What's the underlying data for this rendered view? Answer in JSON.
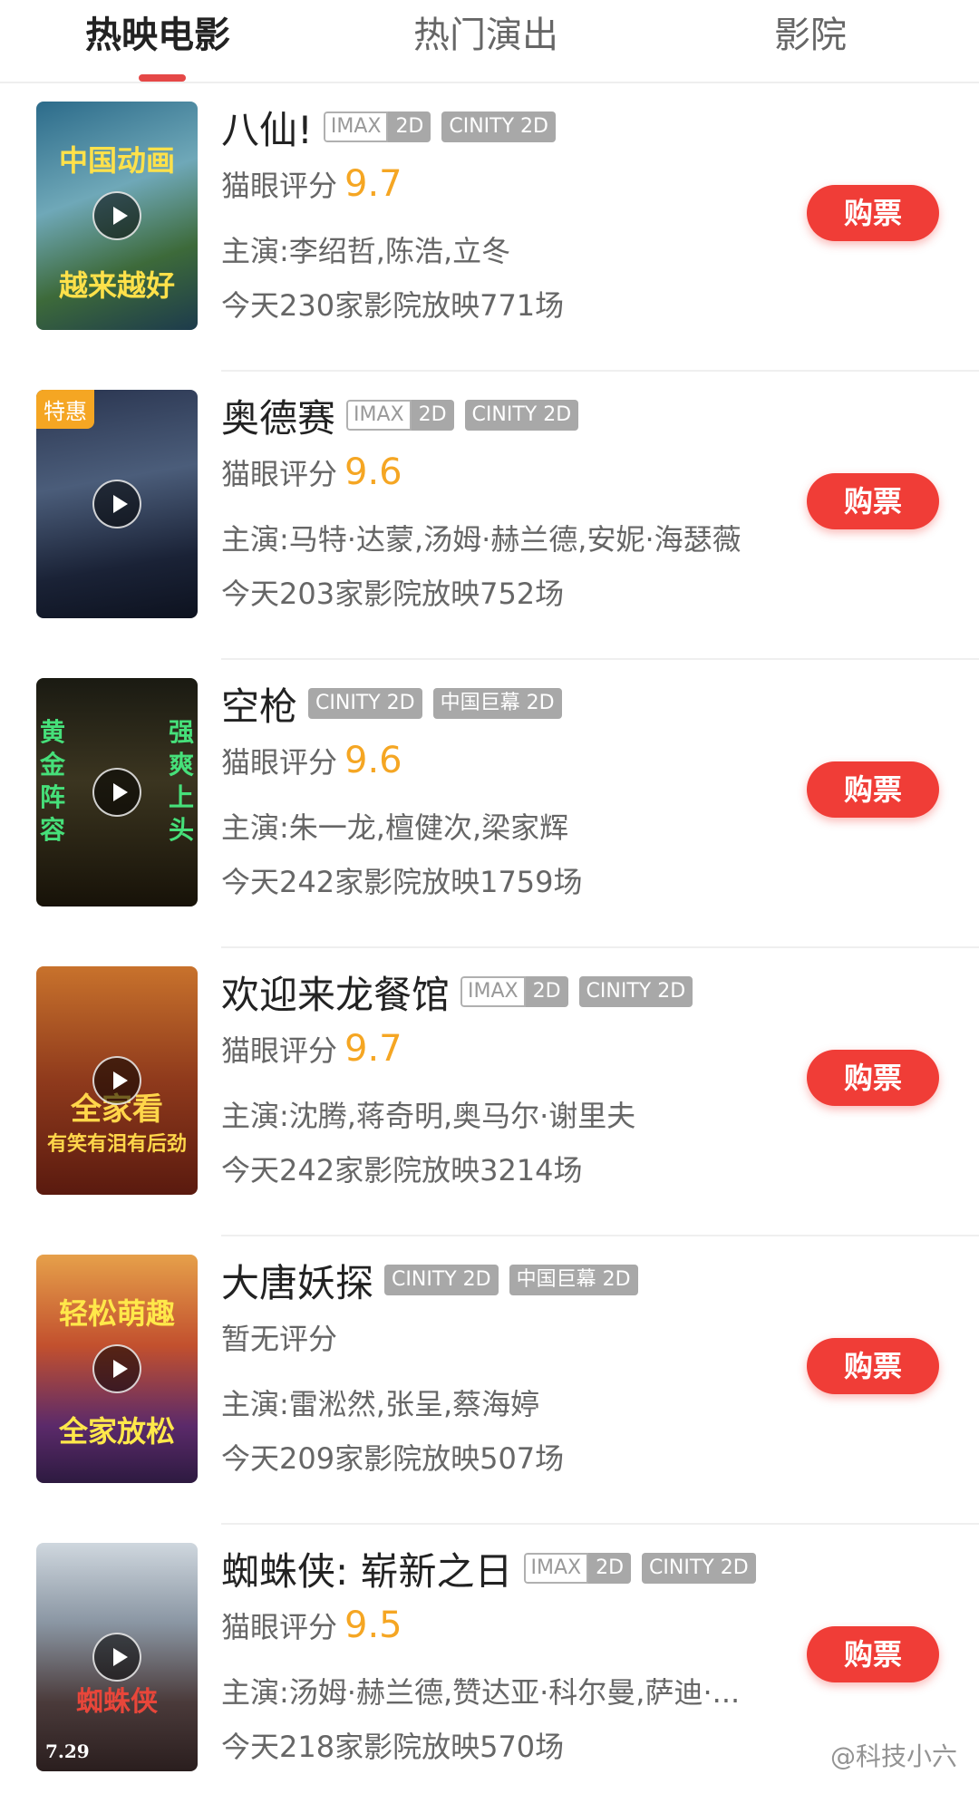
{
  "tabs": [
    {
      "label": "热映电影",
      "active": true
    },
    {
      "label": "热门演出",
      "active": false
    },
    {
      "label": "影院",
      "active": false
    }
  ],
  "movies": [
    {
      "title": "八仙!",
      "tags": [
        {
          "a": "IMAX",
          "b": "2D"
        },
        {
          "solid": "CINITY 2D"
        }
      ],
      "rating_label": "猫眼评分",
      "score": "9.7",
      "cast": "主演:李绍哲,陈浩,立冬",
      "showings": "今天230家影院放映771场",
      "buy_label": "购票",
      "poster_text": [
        "中国动画",
        "越来越好"
      ]
    },
    {
      "title": "奥德赛",
      "tags": [
        {
          "a": "IMAX",
          "b": "2D"
        },
        {
          "solid": "CINITY 2D"
        }
      ],
      "rating_label": "猫眼评分",
      "score": "9.6",
      "cast": "主演:马特·达蒙,汤姆·赫兰德,安妮·海瑟薇",
      "showings": "今天203家影院放映752场",
      "buy_label": "购票",
      "promo": "特惠"
    },
    {
      "title": "空枪",
      "tags": [
        {
          "solid": "CINITY 2D"
        },
        {
          "solid": "中国巨幕 2D"
        }
      ],
      "rating_label": "猫眼评分",
      "score": "9.6",
      "cast": "主演:朱一龙,檀健次,梁家辉",
      "showings": "今天242家影院放映1759场",
      "buy_label": "购票",
      "poster_text": [
        "黄金阵容",
        "强爽上头"
      ]
    },
    {
      "title": "欢迎来龙餐馆",
      "tags": [
        {
          "a": "IMAX",
          "b": "2D"
        },
        {
          "solid": "CINITY 2D"
        }
      ],
      "rating_label": "猫眼评分",
      "score": "9.7",
      "cast": "主演:沈腾,蒋奇明,奥马尔·谢里夫",
      "showings": "今天242家影院放映3214场",
      "buy_label": "购票",
      "poster_text": [
        "全家看",
        "有笑有泪有后劲"
      ]
    },
    {
      "title": "大唐妖探",
      "tags": [
        {
          "solid": "CINITY 2D"
        },
        {
          "solid": "中国巨幕 2D"
        }
      ],
      "rating_label": "暂无评分",
      "score": "",
      "cast": "主演:雷淞然,张呈,蔡海婷",
      "showings": "今天209家影院放映507场",
      "buy_label": "购票",
      "poster_text": [
        "轻松萌趣",
        "全家放松"
      ]
    },
    {
      "title": "蜘蛛侠: 崭新之日",
      "tags": [
        {
          "a": "IMAX",
          "b": "2D"
        },
        {
          "solid": "CINITY 2D"
        }
      ],
      "rating_label": "猫眼评分",
      "score": "9.5",
      "cast": "主演:汤姆·赫兰德,赞达亚·科尔曼,萨迪·...",
      "showings": "今天218家影院放映570场",
      "buy_label": "购票",
      "poster_text": [
        "蜘蛛侠",
        "7.29"
      ]
    }
  ],
  "colors": {
    "accent": "#e54847",
    "button": "#f03d37",
    "score": "#f5a623",
    "tag_gray": "#a8a8a8"
  },
  "watermark": "@科技小六"
}
